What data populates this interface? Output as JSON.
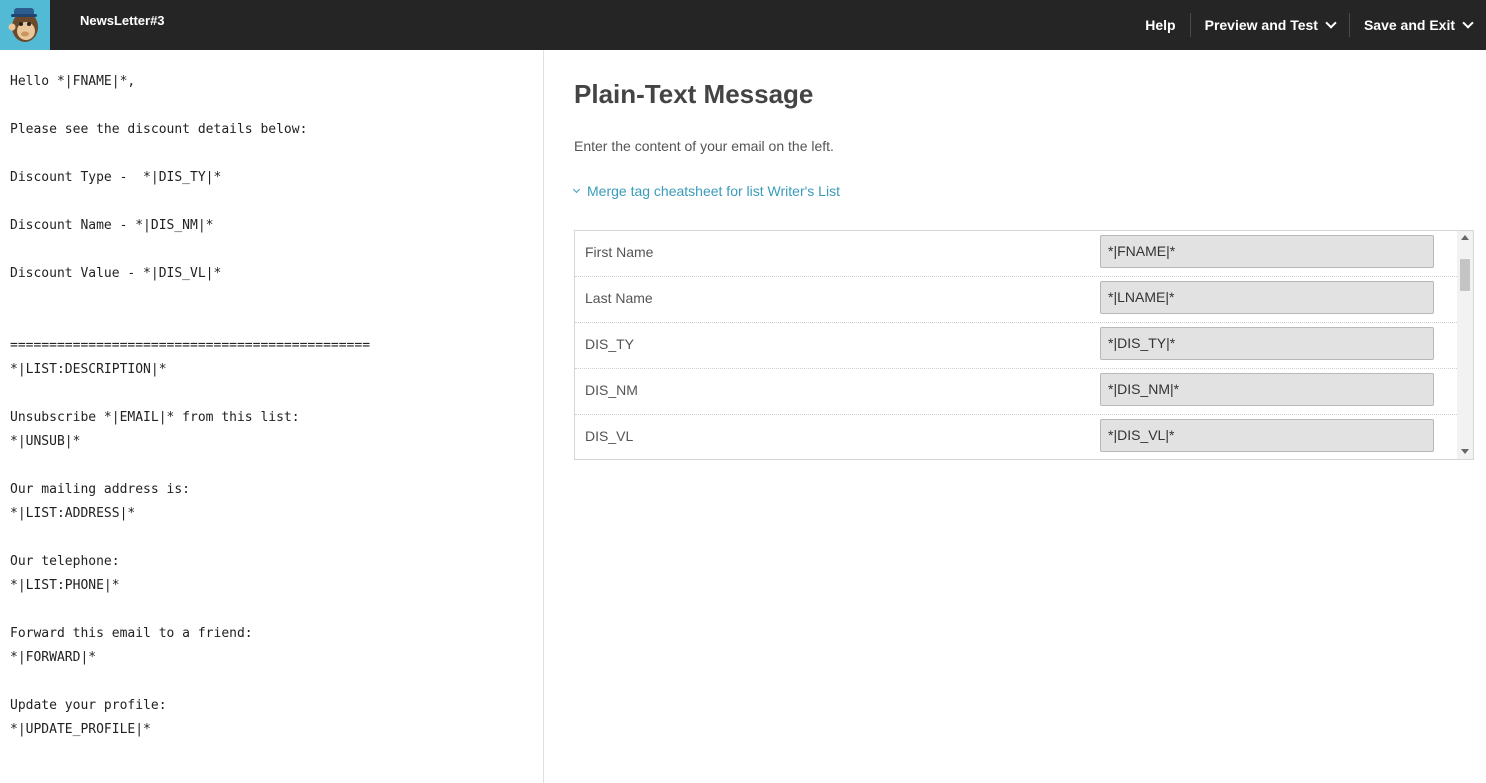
{
  "header": {
    "title": "NewsLetter#3",
    "help_label": "Help",
    "preview_label": "Preview and Test",
    "save_label": "Save and Exit"
  },
  "editor": {
    "content": "Hello *|FNAME|*,\n\nPlease see the discount details below:\n\nDiscount Type -  *|DIS_TY|*\n\nDiscount Name - *|DIS_NM|*\n\nDiscount Value - *|DIS_VL|*\n\n\n==============================================\n*|LIST:DESCRIPTION|*\n\nUnsubscribe *|EMAIL|* from this list:\n*|UNSUB|*\n\nOur mailing address is:\n*|LIST:ADDRESS|*\n\nOur telephone:\n*|LIST:PHONE|*\n\nForward this email to a friend:\n*|FORWARD|*\n\nUpdate your profile:\n*|UPDATE_PROFILE|*"
  },
  "panel": {
    "heading": "Plain-Text Message",
    "intro": "Enter the content of your email on the left.",
    "cheatsheet_link": "Merge tag cheatsheet for list Writer's List",
    "tags": [
      {
        "name": "First Name",
        "value": "*|FNAME|*"
      },
      {
        "name": "Last Name",
        "value": "*|LNAME|*"
      },
      {
        "name": "DIS_TY",
        "value": "*|DIS_TY|*"
      },
      {
        "name": "DIS_NM",
        "value": "*|DIS_NM|*"
      },
      {
        "name": "DIS_VL",
        "value": "*|DIS_VL|*"
      }
    ]
  }
}
